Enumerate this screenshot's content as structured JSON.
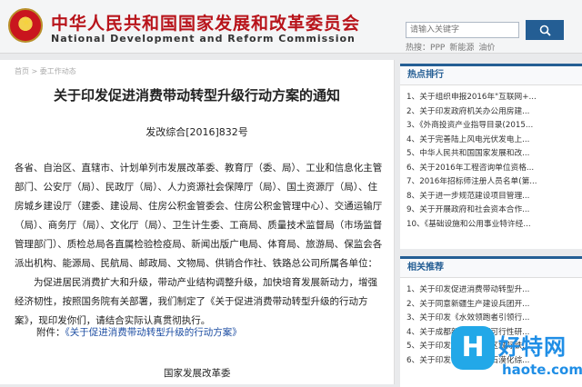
{
  "header": {
    "title_cn": "中华人民共和国国家发展和改革委员会",
    "title_en": "National Development and Reform Commission",
    "search_placeholder": "请输入关键字",
    "hot_label": "热搜：",
    "hot_terms": [
      "PPP",
      "新能源",
      "油价"
    ]
  },
  "breadcrumb": "首页 > 委工作动态",
  "article": {
    "title": "关于印发促进消费带动转型升级行动方案的通知",
    "doc_number": "发改综合[2016]832号",
    "recipients": "各省、自治区、直辖市、计划单列市发展改革委、教育厅（委、局）、工业和信息化主管部门、公安厅（局）、民政厅（局）、人力资源社会保障厅（局）、国土资源厅（局）、住房城乡建设厅（建委、建设局、住房公积金管委会、住房公积金管理中心）、交通运输厅（局）、商务厅（局）、文化厅（局）、卫生计生委、工商局、质量技术监督局（市场监督管理部门）、质检总局各直属检验检疫局、新闻出版广电局、体育局、旅游局、保监会各派出机构、能源局、民航局、邮政局、文物局、供销合作社、铁路总公司所属各单位：",
    "paragraph": "为促进居民消费扩大和升级，带动产业结构调整升级，加快培育发展新动力，增强经济韧性，按照国务院有关部署，我们制定了《关于促进消费带动转型升级的行动方案》，现印发你们，请结合实际认真贯彻执行。",
    "attachment_label": "附件：",
    "attachment_link": "《关于促进消费带动转型升级的行动方案》",
    "signature": "国家发展改革委"
  },
  "hot_panel": {
    "title": "热点排行",
    "items": [
      "1、关于组织申报2016年\"互联网+...",
      "2、关于印发政府机关办公用房建...",
      "3、《外商投资产业指导目录(2015...",
      "4、关于完善陆上风电光伏发电上...",
      "5、中华人民共和国国家发展和改...",
      "6、关于2016年工程咨询单位资格...",
      "7、2016年招标师注册人员名单(第...",
      "8、关于进一步规范建设项目管理...",
      "9、关于开展政府和社会资本合作...",
      "10、《基础设施和公用事业特许经..."
    ]
  },
  "related_panel": {
    "title": "相关推荐",
    "items": [
      "1、关于印发促进消费带动转型升...",
      "2、关于同意新疆生产建设兵团开...",
      "3、关于印发《水效领跑者引领行...",
      "4、关于成都新机场工程可行性研...",
      "5、关于印发《京津冀地区城际铁...",
      "6、关于印发《石漠地区石漠化综..."
    ]
  },
  "watermark": {
    "logo_char": "H",
    "cn": "好特网",
    "url": "haote.com"
  },
  "colors": {
    "brand_red": "#b8141b",
    "brand_blue": "#245e94",
    "watermark_blue": "#1f8ee6"
  }
}
